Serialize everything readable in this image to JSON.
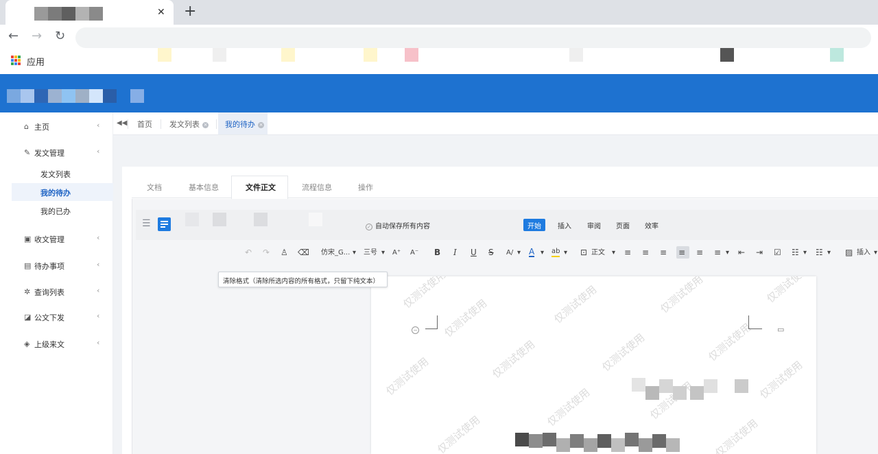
{
  "browser": {
    "tab_close_glyph": "✕",
    "new_tab_glyph": "+",
    "back_glyph": "←",
    "forward_glyph": "→",
    "reload_glyph": "↻",
    "apps_label": "应用"
  },
  "sidebar": {
    "items": [
      {
        "icon": "home-icon",
        "glyph": "⌂",
        "label": "主页"
      },
      {
        "icon": "edit-icon",
        "glyph": "✎",
        "label": "发文管理"
      },
      {
        "icon": "inbox-icon",
        "glyph": "▣",
        "label": "收文管理"
      },
      {
        "icon": "todo-icon",
        "glyph": "▤",
        "label": "待办事项"
      },
      {
        "icon": "query-icon",
        "glyph": "✲",
        "label": "查询列表"
      },
      {
        "icon": "publish-icon",
        "glyph": "◪",
        "label": "公文下发"
      },
      {
        "icon": "upper-icon",
        "glyph": "◈",
        "label": "上级来文"
      }
    ],
    "caret": "‹",
    "sub_items": [
      {
        "label": "发文列表",
        "active": false
      },
      {
        "label": "我的待办",
        "active": true
      },
      {
        "label": "我的已办",
        "active": false
      }
    ]
  },
  "page_tabs": {
    "collapse_glyph": "◀◀",
    "tabs": [
      {
        "label": "首页",
        "closable": false
      },
      {
        "label": "发文列表",
        "closable": true
      },
      {
        "label": "我的待办",
        "closable": true,
        "active": true
      }
    ],
    "close_glyph": "×"
  },
  "section_tabs": [
    {
      "label": "文档"
    },
    {
      "label": "基本信息"
    },
    {
      "label": "文件正文",
      "active": true
    },
    {
      "label": "流程信息"
    },
    {
      "label": "操作"
    }
  ],
  "editor": {
    "menu_glyph": "☰",
    "autosave_label": "自动保存所有内容",
    "autosave_check": "✓",
    "ribbon_tabs": [
      {
        "label": "开始",
        "active": true
      },
      {
        "label": "插入"
      },
      {
        "label": "审阅"
      },
      {
        "label": "页面"
      },
      {
        "label": "效率"
      }
    ],
    "toolbar": {
      "undo": "↶",
      "redo": "↷",
      "format_painter": "♙",
      "clear_format": "⌫",
      "font": "仿宋_G...",
      "size": "三号",
      "grow": "A⁺",
      "shrink": "A⁻",
      "bold": "B",
      "italic": "I",
      "underline": "U",
      "strike": "S",
      "superscript": "A/",
      "font_color": "A",
      "highlight": "ab",
      "style_icon": "⊡",
      "style_label": "正文",
      "align_left": "≡",
      "align_center": "≡",
      "align_right": "≡",
      "justify": "≡",
      "distribute": "≡",
      "line_spacing": "≡",
      "indent_dec": "⇤",
      "indent_inc": "⇥",
      "checkbox": "☑",
      "bullets": "☷",
      "numbering": "☷",
      "insert_icon": "▨",
      "insert_label": "插入",
      "dropdown": "▾"
    },
    "tooltip": "清除格式（清除所选内容的所有格式，只留下纯文本）",
    "watermark": "仅测试使用",
    "minus_glyph": "−",
    "comment_glyph": "▭"
  }
}
